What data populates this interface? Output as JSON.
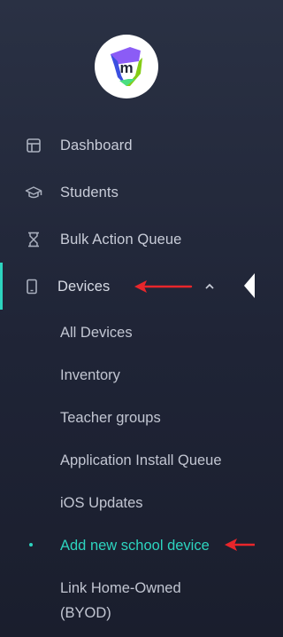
{
  "brand": {
    "logo_letter": "m"
  },
  "nav": {
    "dashboard": "Dashboard",
    "students": "Students",
    "bulk_action_queue": "Bulk Action Queue",
    "devices": "Devices"
  },
  "devices_submenu": [
    {
      "label": "All Devices"
    },
    {
      "label": "Inventory"
    },
    {
      "label": "Teacher groups"
    },
    {
      "label": "Application Install Queue"
    },
    {
      "label": "iOS Updates"
    },
    {
      "label": "Add new school device"
    },
    {
      "label": "Link Home-Owned"
    },
    {
      "label": "(BYOD)"
    }
  ],
  "colors": {
    "accent": "#2dd4bf",
    "annotation_arrow": "#e8262b",
    "text": "#c8ccd8"
  },
  "icons": {
    "dashboard": "layout-icon",
    "students": "graduation-cap-icon",
    "bulk_action_queue": "hourglass-icon",
    "devices": "tablet-icon"
  }
}
